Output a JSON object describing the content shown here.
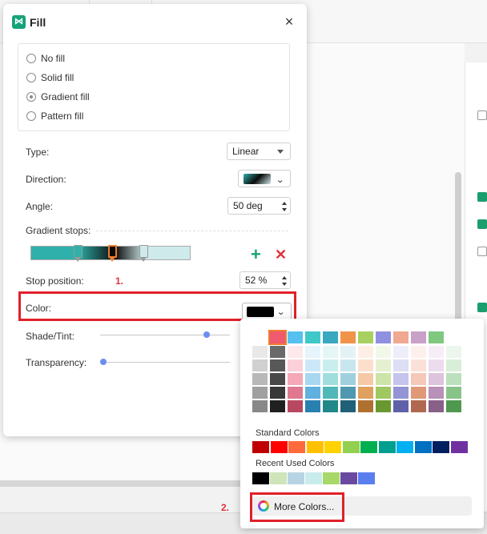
{
  "dialog": {
    "title": "Fill",
    "close_icon": "close-icon",
    "fill_options": [
      "No fill",
      "Solid fill",
      "Gradient fill",
      "Pattern fill"
    ],
    "selected_fill": "Gradient fill",
    "type_label": "Type:",
    "type_value": "Linear",
    "direction_label": "Direction:",
    "angle_label": "Angle:",
    "angle_value": "50 deg",
    "gradient_stops_label": "Gradient stops:",
    "gradient_colors": [
      "#2fb0aa",
      "#0a0a0a",
      "#cfeaea"
    ],
    "stop_position_label": "Stop position:",
    "stop_position_value": "52 %",
    "color_label": "Color:",
    "color_value": "#000000",
    "shade_tint_label": "Shade/Tint:",
    "shade_tint_level": 0.82,
    "transparency_label": "Transparency:",
    "transparency_level": 0.0
  },
  "annotations": {
    "step1": "1.",
    "step2": "2."
  },
  "palette": {
    "theme_top_row": [
      "#000000",
      "#f05a6e",
      "#56c0f0",
      "#3ec8c8",
      "#3aa8c0",
      "#f0944a",
      "#a8d060",
      "#9090e0",
      "#f0a890",
      "#c8a0c8",
      "#80c880"
    ],
    "theme_columns": [
      [
        "#e8e8e8",
        "#d0d0d0",
        "#b8b8b8",
        "#a0a0a0",
        "#888888"
      ],
      [
        "#6a6a6a",
        "#585858",
        "#484848",
        "#383838",
        "#202020"
      ],
      [
        "#fde8ec",
        "#fbd0d8",
        "#f5a8b8",
        "#e07890",
        "#b84860"
      ],
      [
        "#e6f4fc",
        "#cce8f8",
        "#a8d8f0",
        "#60b0e0",
        "#2880b0"
      ],
      [
        "#e4f6f6",
        "#c8eeee",
        "#a0dede",
        "#50b8b8",
        "#208888"
      ],
      [
        "#e4f2f6",
        "#c8e6ee",
        "#a0d0de",
        "#5098b0",
        "#206078"
      ],
      [
        "#fdefe6",
        "#fbdfcc",
        "#f5c8a8",
        "#e0a060",
        "#b07030"
      ],
      [
        "#f2f8e8",
        "#e4f0d0",
        "#cce4a8",
        "#a0c860",
        "#6a9830"
      ],
      [
        "#eeeefa",
        "#ddddf4",
        "#c4c4ec",
        "#9494d4",
        "#6060a8"
      ],
      [
        "#fdf0ec",
        "#fbe0d8",
        "#f5c8b8",
        "#e09878",
        "#b06850"
      ],
      [
        "#f6eef6",
        "#ecdcec",
        "#dcc4dc",
        "#b890b8",
        "#886088"
      ],
      [
        "#ecf6ec",
        "#d8eed8",
        "#bce0bc",
        "#88c488",
        "#509850"
      ]
    ],
    "standard_colors_label": "Standard Colors",
    "standard_colors": [
      "#c00000",
      "#ff0000",
      "#ff6a3c",
      "#ffc000",
      "#ffd200",
      "#92d050",
      "#00b050",
      "#00a090",
      "#00b0f0",
      "#0070c0",
      "#002060",
      "#7030a0"
    ],
    "recent_colors_label": "Recent Used Colors",
    "recent_colors": [
      "#000000",
      "#cfe4b8",
      "#b8d4e4",
      "#c8ecec",
      "#a8d868",
      "#6a4aa0",
      "#5a7ef0"
    ],
    "more_colors_label": "More Colors..."
  }
}
